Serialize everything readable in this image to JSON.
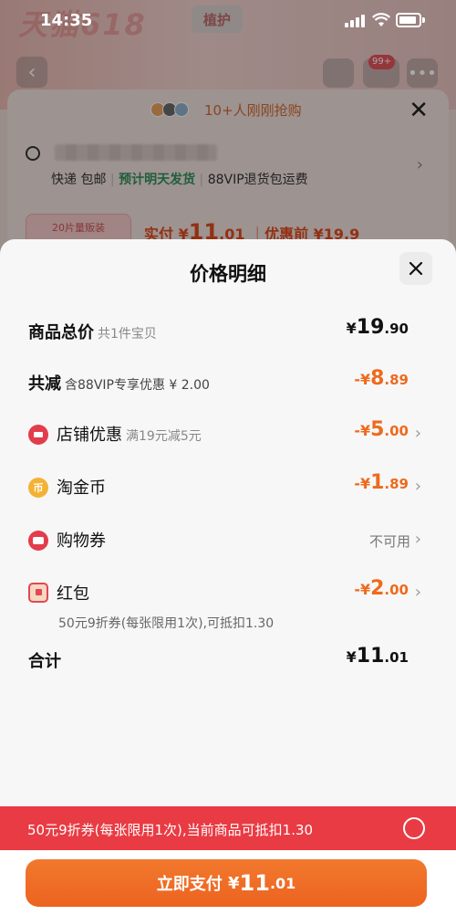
{
  "status_bar": {
    "time": "14:35"
  },
  "background": {
    "hero_text": "天猫618",
    "hero_tag": "植护",
    "cart_badge": "99+",
    "buyers_text": "10+人刚刚抢购",
    "shipping": {
      "express": "快递 包邮",
      "eta": "预计明天发货",
      "vip": "88VIP退货包运费"
    },
    "product_thumb_label": "20片量贩装",
    "paid": {
      "label": "实付",
      "currency": "¥",
      "int": "11",
      "dec": ".01",
      "before": "优惠前 ¥19.9"
    }
  },
  "sheet": {
    "title": "价格明细",
    "rows": {
      "total": {
        "label": "商品总价",
        "note": "共1件宝贝",
        "currency": "¥",
        "int": "19",
        "dec": ".90"
      },
      "reduce": {
        "label": "共减",
        "note": "含88VIP专享优惠 ¥ 2.00",
        "currency": "-¥",
        "int": "8",
        "dec": ".89"
      },
      "shop": {
        "label": "店铺优惠",
        "note": "满19元减5元",
        "currency": "-¥",
        "int": "5",
        "dec": ".00"
      },
      "coin": {
        "label": "淘金币",
        "currency": "-¥",
        "int": "1",
        "dec": ".89"
      },
      "voucher": {
        "label": "购物券",
        "value": "不可用"
      },
      "redpack": {
        "label": "红包",
        "currency": "-¥",
        "int": "2",
        "dec": ".00",
        "sub": "50元9折券(每张限用1次),可抵扣1.30"
      },
      "sum": {
        "label": "合计",
        "currency": "¥",
        "int": "11",
        "dec": ".01"
      }
    }
  },
  "coupon_bar": {
    "text": "50元9折券(每张限用1次),当前商品可抵扣1.30"
  },
  "pay_button": {
    "label": "立即支付",
    "currency": "¥",
    "int": "11",
    "dec": ".01"
  },
  "colors": {
    "accent": "#ee6a1d",
    "red": "#e93b43",
    "sheet_bg": "#f7f7f7"
  },
  "icons": [
    "back-icon",
    "share-icon",
    "cart-icon",
    "more-icon",
    "close-icon",
    "location-icon",
    "shop-discount-icon",
    "coin-icon",
    "voucher-icon",
    "red-packet-icon",
    "chevron-right-icon",
    "radio-icon"
  ]
}
